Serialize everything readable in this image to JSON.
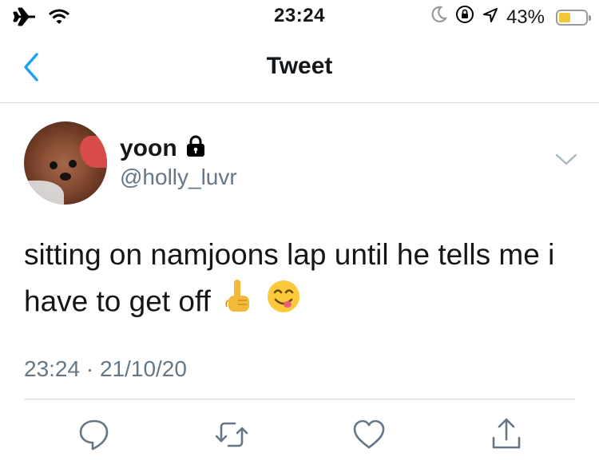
{
  "status_bar": {
    "time": "23:24",
    "battery_percent": "43%",
    "battery_level": 0.43,
    "icons": [
      "airplane-icon",
      "wifi-icon",
      "moon-icon",
      "orientation-lock-icon",
      "location-icon",
      "battery-icon"
    ]
  },
  "nav": {
    "title": "Tweet",
    "back_icon": "chevron-left-icon"
  },
  "tweet": {
    "display_name": "yoon",
    "handle": "@holly_luvr",
    "protected_icon": "lock-icon",
    "text": "sitting on namjoons lap until he tells me i have to get off",
    "emojis": [
      "pointing-up-emoji",
      "yum-face-emoji"
    ],
    "timestamp": "23:24 · 21/10/20"
  },
  "actions": [
    "reply-icon",
    "retweet-icon",
    "like-icon",
    "share-icon"
  ],
  "colors": {
    "accent": "#1da1f2",
    "secondary_text": "#657786",
    "action_icon": "#657786",
    "battery_fill": "#f4c73b"
  }
}
